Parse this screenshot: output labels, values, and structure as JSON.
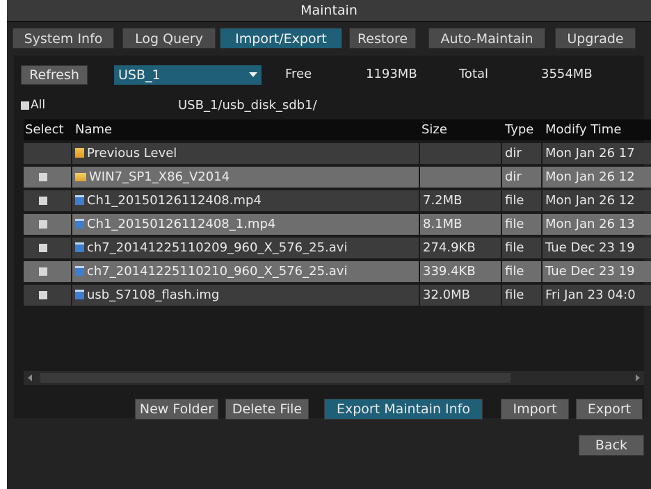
{
  "window": {
    "title": "Maintain"
  },
  "tabs": [
    {
      "label": "System Info"
    },
    {
      "label": "Log Query"
    },
    {
      "label": "Import/Export",
      "active": true
    },
    {
      "label": "Restore"
    },
    {
      "label": "Auto-Maintain"
    },
    {
      "label": "Upgrade"
    }
  ],
  "toolbar": {
    "refresh_label": "Refresh",
    "device_value": "USB_1",
    "free_label": "Free",
    "free_value": "1193MB",
    "total_label": "Total",
    "total_value": "3554MB"
  },
  "path_bar": {
    "all_label": "All",
    "path": "USB_1/usb_disk_sdb1/"
  },
  "table": {
    "headers": {
      "select": "Select",
      "name": "Name",
      "size": "Size",
      "type": "Type",
      "modify_time": "Modify Time"
    },
    "rows": [
      {
        "icon": "up-level-icon",
        "name": "Previous Level",
        "size": "",
        "type": "dir",
        "modify_time": "Mon Jan 26 17",
        "checkbox": false
      },
      {
        "icon": "folder-icon",
        "name": "WIN7_SP1_X86_V2014",
        "size": "",
        "type": "dir",
        "modify_time": "Mon Jan 26 12",
        "checkbox": true
      },
      {
        "icon": "file-icon",
        "name": "Ch1_20150126112408.mp4",
        "size": "7.2MB",
        "type": "file",
        "modify_time": "Mon Jan 26 12",
        "checkbox": true
      },
      {
        "icon": "file-icon",
        "name": "Ch1_20150126112408_1.mp4",
        "size": "8.1MB",
        "type": "file",
        "modify_time": "Mon Jan 26 13",
        "checkbox": true
      },
      {
        "icon": "file-icon",
        "name": "ch7_20141225110209_960_X_576_25.avi",
        "size": "274.9KB",
        "type": "file",
        "modify_time": "Tue Dec 23 19",
        "checkbox": true
      },
      {
        "icon": "file-icon",
        "name": "ch7_20141225110210_960_X_576_25.avi",
        "size": "339.4KB",
        "type": "file",
        "modify_time": "Tue Dec 23 19",
        "checkbox": true
      },
      {
        "icon": "file-icon",
        "name": "usb_S7108_flash.img",
        "size": "32.0MB",
        "type": "file",
        "modify_time": "Fri Jan 23 04:0",
        "checkbox": true
      }
    ]
  },
  "actions": {
    "new_folder": "New Folder",
    "delete_file": "Delete File",
    "export_maintain_info": "Export Maintain Info",
    "import": "Import",
    "export": "Export",
    "back": "Back"
  },
  "colors": {
    "accent": "#1f5f77",
    "background": "#232323"
  }
}
